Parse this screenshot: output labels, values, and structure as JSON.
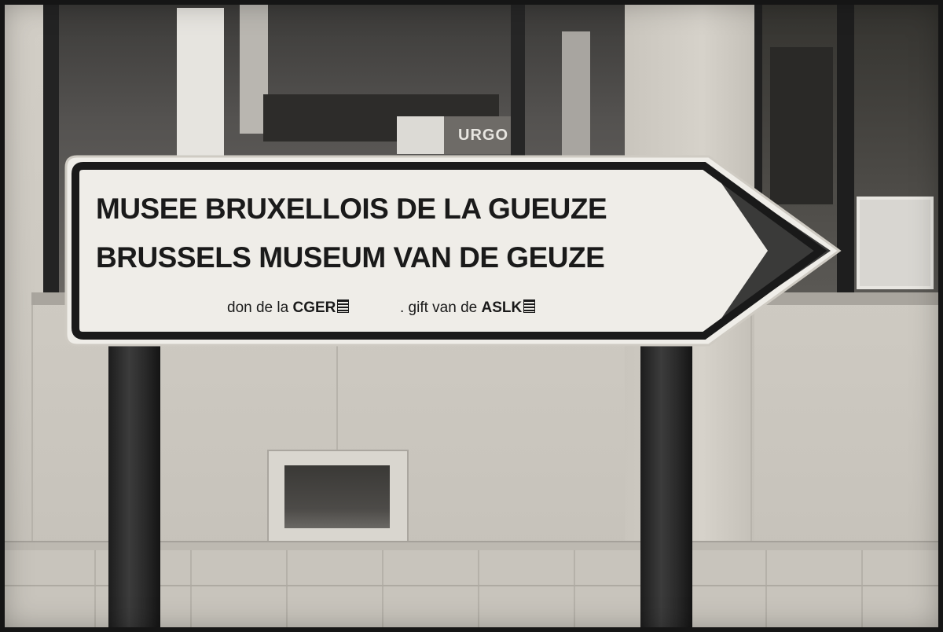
{
  "scene": {
    "storefront_sign": "URGO"
  },
  "sign": {
    "line1": "MUSEE BRUXELLOIS DE LA GUEUZE",
    "line2": "BRUSSELS MUSEUM VAN DE GEUZE",
    "donor_fr_prefix": "don de la",
    "donor_fr_name": "CGER",
    "donor_nl_prefix": ". gift van de",
    "donor_nl_name": "ASLK",
    "direction": "right-arrow-icon"
  },
  "colors": {
    "sign_face": "#efede8",
    "sign_text": "#1a1a1a",
    "sign_border": "#1a1a1a"
  }
}
